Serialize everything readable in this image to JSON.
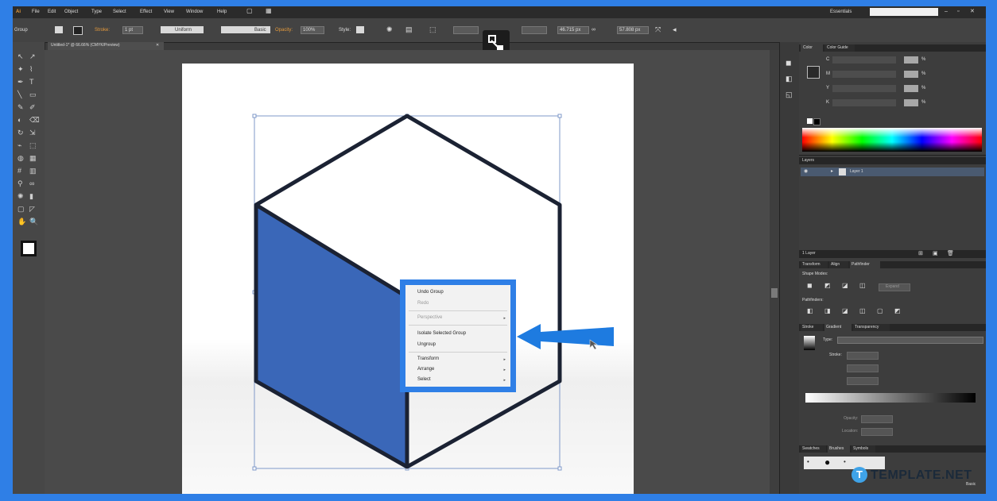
{
  "colors": {
    "frame": "#2f7fe6",
    "ui_dark": "#3b3b3b",
    "arrow": "#1e7be0",
    "cube_side": "#3a67b8",
    "cube_stroke": "#1b2233"
  },
  "menubar": {
    "items": [
      "File",
      "Edit",
      "Object",
      "Type",
      "Select",
      "Effect",
      "View",
      "Window",
      "Help"
    ],
    "workspace": "Essentials"
  },
  "control_bar": {
    "label_group": "Group",
    "stroke_label": "Stroke:",
    "stroke_weight": "1 pt",
    "uniform": "Uniform",
    "basic": "Basic",
    "opacity_label": "Opacity:",
    "opacity": "100%",
    "style_label": "Style:",
    "width_value": "46.715 px",
    "height_value": "57.808 px"
  },
  "document": {
    "tab_title": "Untitled-1* @ 66.66% (CMYK/Preview)"
  },
  "tools": {
    "icons": [
      "selection-tool-icon",
      "direct-selection-tool-icon",
      "magic-wand-tool-icon",
      "lasso-tool-icon",
      "pen-tool-icon",
      "type-tool-icon",
      "line-tool-icon",
      "rectangle-tool-icon",
      "paintbrush-tool-icon",
      "pencil-tool-icon",
      "blob-brush-tool-icon",
      "eraser-tool-icon",
      "rotate-tool-icon",
      "scale-tool-icon",
      "width-tool-icon",
      "free-transform-tool-icon",
      "shape-builder-tool-icon",
      "perspective-tool-icon",
      "mesh-tool-icon",
      "gradient-tool-icon",
      "eyedropper-tool-icon",
      "blend-tool-icon",
      "symbol-sprayer-tool-icon",
      "column-graph-tool-icon",
      "artboard-tool-icon",
      "slice-tool-icon",
      "hand-tool-icon",
      "zoom-tool-icon"
    ],
    "glyphs": [
      "↖",
      "↗",
      "✦",
      "⌇",
      "✒",
      "T",
      "╲",
      "▭",
      "✎",
      "✐",
      "◐",
      "⌫",
      "↻",
      "⇲",
      "⌁",
      "⬚",
      "◍",
      "▦",
      "#",
      "▥",
      "⚲",
      "∞",
      "✺",
      "▮",
      "▢",
      "◸",
      "✋",
      "🔍"
    ]
  },
  "panels": {
    "color_tabs": [
      "Color",
      "Color Guide"
    ],
    "color_channels": [
      "C",
      "M",
      "Y",
      "K"
    ],
    "color_unit": "%",
    "layers_header": "Layers",
    "layer_name": "Layer 1",
    "layers_count": "1 Layer",
    "pathfinder_tabs": [
      "Transform",
      "Align",
      "Pathfinder"
    ],
    "shape_modes": "Shape Modes:",
    "pathfinders": "Pathfinders:",
    "expand": "Expand",
    "gradient_tabs": [
      "Stroke",
      "Gradient",
      "Transparency"
    ],
    "gradient_type": "Type:",
    "gradient_stroke": "Stroke:",
    "gradient_opacity": "Opacity:",
    "gradient_location": "Location:",
    "brushes_tabs": [
      "Swatches",
      "Brushes",
      "Symbols"
    ],
    "basic": "Basic"
  },
  "context_menu": {
    "items": [
      {
        "label": "Undo Group",
        "enabled": true,
        "submenu": false
      },
      {
        "label": "Redo",
        "enabled": false,
        "submenu": false
      },
      {
        "label": "Perspective",
        "enabled": false,
        "submenu": true
      },
      {
        "label": "Isolate Selected Group",
        "enabled": true,
        "submenu": false
      },
      {
        "label": "Ungroup",
        "enabled": true,
        "submenu": false
      },
      {
        "label": "Transform",
        "enabled": true,
        "submenu": true
      },
      {
        "label": "Arrange",
        "enabled": true,
        "submenu": true
      },
      {
        "label": "Select",
        "enabled": true,
        "submenu": true
      }
    ]
  },
  "watermark": {
    "icon_letter": "T",
    "text": "TEMPLATE.NET"
  }
}
